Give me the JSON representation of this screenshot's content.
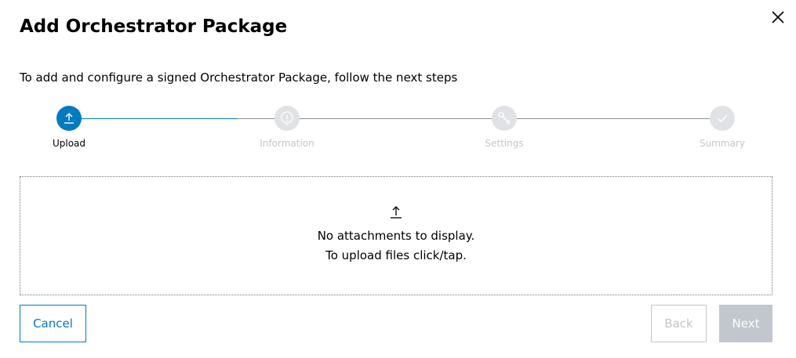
{
  "dialog": {
    "title": "Add Orchestrator Package",
    "close_icon": "close-icon",
    "subtitle": "To add and configure a signed Orchestrator Package, follow the next steps"
  },
  "stepper": {
    "steps": [
      {
        "label": "Upload",
        "icon": "upload-icon",
        "state": "active"
      },
      {
        "label": "Information",
        "icon": "info-icon",
        "state": "inactive"
      },
      {
        "label": "Settings",
        "icon": "wrench-icon",
        "state": "inactive"
      },
      {
        "label": "Summary",
        "icon": "checkmark-icon",
        "state": "inactive"
      }
    ]
  },
  "upload": {
    "icon": "upload-icon",
    "empty_text": "No attachments to display.",
    "hint_text": "To upload files click/tap."
  },
  "footer": {
    "cancel_label": "Cancel",
    "back_label": "Back",
    "next_label": "Next"
  },
  "colors": {
    "accent": "#007bc0",
    "disabled": "#c1c7cc",
    "inactive_circle": "#e0e2e5",
    "line": "#8a9097"
  }
}
